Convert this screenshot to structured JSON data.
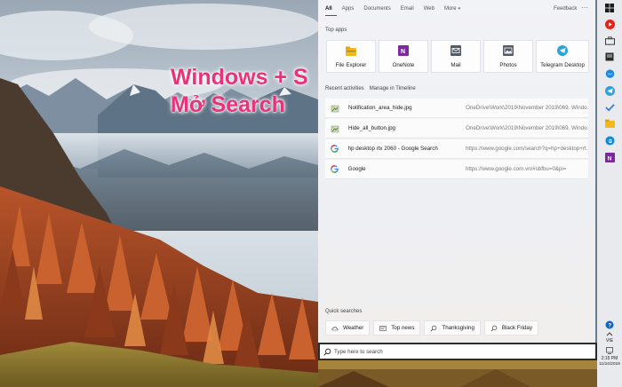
{
  "overlay": {
    "line1": "Windows + S",
    "line2": "Mở Search"
  },
  "search_panel": {
    "tabs": [
      {
        "label": "All",
        "active": true
      },
      {
        "label": "Apps",
        "active": false
      },
      {
        "label": "Documents",
        "active": false
      },
      {
        "label": "Email",
        "active": false
      },
      {
        "label": "Web",
        "active": false
      },
      {
        "label": "More",
        "active": false
      }
    ],
    "feedback_label": "Feedback",
    "more_options_label": "···",
    "top_apps_title": "Top apps",
    "top_apps": [
      {
        "label": "File Explorer",
        "icon": "folder-icon",
        "color": "#f2b91d"
      },
      {
        "label": "OneNote",
        "icon": "onenote-icon",
        "color": "#7a2a9c"
      },
      {
        "label": "Mail",
        "icon": "mail-icon",
        "color": "#555b66"
      },
      {
        "label": "Photos",
        "icon": "photos-icon",
        "color": "#555b66"
      },
      {
        "label": "Telegram Desktop",
        "icon": "telegram-icon",
        "color": "#2aa3df"
      }
    ],
    "recent_title": "Recent activities",
    "manage_timeline_label": "Manage in Timeline",
    "recent": [
      {
        "name": "Notification_area_hide.jpg",
        "path": "OneDrive\\Work\\2019\\November 2019\\069. Windo...",
        "icon": "image-file-icon"
      },
      {
        "name": "Hide_all_button.jpg",
        "path": "OneDrive\\Work\\2019\\November 2019\\069. Windo...",
        "icon": "image-file-icon"
      },
      {
        "name": "hp desktop rtx 2060 - Google Search",
        "path": "https://www.google.com/search?q=hp+desktop+rt...",
        "icon": "google-icon"
      },
      {
        "name": "Google",
        "path": "https://www.google.com.vn/#sbfbu=0&pi=",
        "icon": "google-icon"
      }
    ],
    "quick_title": "Quick searches",
    "quick": [
      {
        "label": "Weather",
        "icon": "weather-icon"
      },
      {
        "label": "Top news",
        "icon": "news-icon"
      },
      {
        "label": "Thanksgiving",
        "icon": "search-icon"
      },
      {
        "label": "Black Friday",
        "icon": "search-icon"
      }
    ]
  },
  "search_box": {
    "placeholder": "Type here to search",
    "value": ""
  },
  "taskbar": {
    "pinned": [
      {
        "name": "windows-start-icon",
        "color": "#1a1a1a"
      },
      {
        "name": "youtube-icon",
        "color": "#e62117"
      },
      {
        "name": "briefcase-icon",
        "color": "#2b2b2b"
      },
      {
        "name": "notes-icon",
        "color": "#2b2b2b"
      },
      {
        "name": "messenger-icon",
        "color": "#1e88e5"
      },
      {
        "name": "telegram-icon",
        "color": "#2aa3df"
      },
      {
        "name": "checkmark-icon",
        "color": "#3d7bd8"
      },
      {
        "name": "file-explorer-icon",
        "color": "#f2b91d"
      },
      {
        "name": "edge-icon",
        "color": "#0f8ad8"
      },
      {
        "name": "onenote-icon",
        "color": "#7a2a9c"
      }
    ],
    "language": "VIE",
    "time": "2:15 PM",
    "date": "11/24/2019"
  }
}
